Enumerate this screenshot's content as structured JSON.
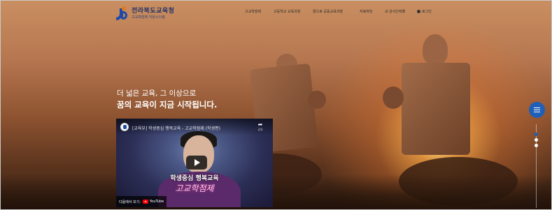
{
  "header": {
    "logo_title": "전라북도교육청",
    "logo_subtitle": "고교학점제 지원시스템",
    "nav": [
      {
        "label": "고교학점제"
      },
      {
        "label": "고등학교 교육과정"
      },
      {
        "label": "꿈으로 공동교육과정"
      },
      {
        "label": "자료마당"
      },
      {
        "label": "교·강사인력풀"
      },
      {
        "label": "로그인",
        "icon": "user-icon"
      }
    ]
  },
  "hero": {
    "line1": "더 넓은 교육, 그 이상으로",
    "line2": "꿈의 교육이 지금 시작됩니다."
  },
  "video": {
    "title": "[교육부] 학생중심 행복교육 - 고교학점제 (학생편)",
    "share_label": "공유",
    "promo_line1": "학생중심 행복교육",
    "promo_line2": "고교학점제",
    "watch_on_label": "다음에서 보기:",
    "youtube_label": "YouTube"
  },
  "colors": {
    "accent": "#1f5fb8",
    "logo_blue": "#1f4aa8",
    "logo_orange": "#e27a1d"
  },
  "pager": {
    "count": 2,
    "active": 0
  }
}
